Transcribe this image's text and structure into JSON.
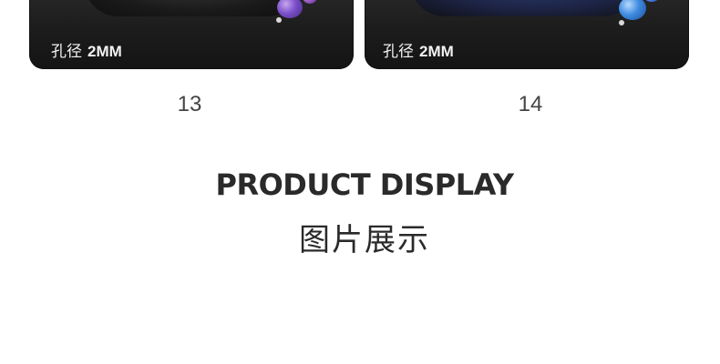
{
  "cards": [
    {
      "spec_label": "孔径",
      "spec_value": "2MM",
      "number": "13",
      "accent": "#7b4fc9"
    },
    {
      "spec_label": "孔径",
      "spec_value": "2MM",
      "number": "14",
      "accent": "#3d8be0"
    }
  ],
  "section": {
    "title_en": "PRODUCT DISPLAY",
    "title_cn": "图片展示"
  },
  "colors": {
    "card_background": "#1c1c1c",
    "text_dark": "#2a2a2a",
    "text_light": "#f2f2f2"
  }
}
